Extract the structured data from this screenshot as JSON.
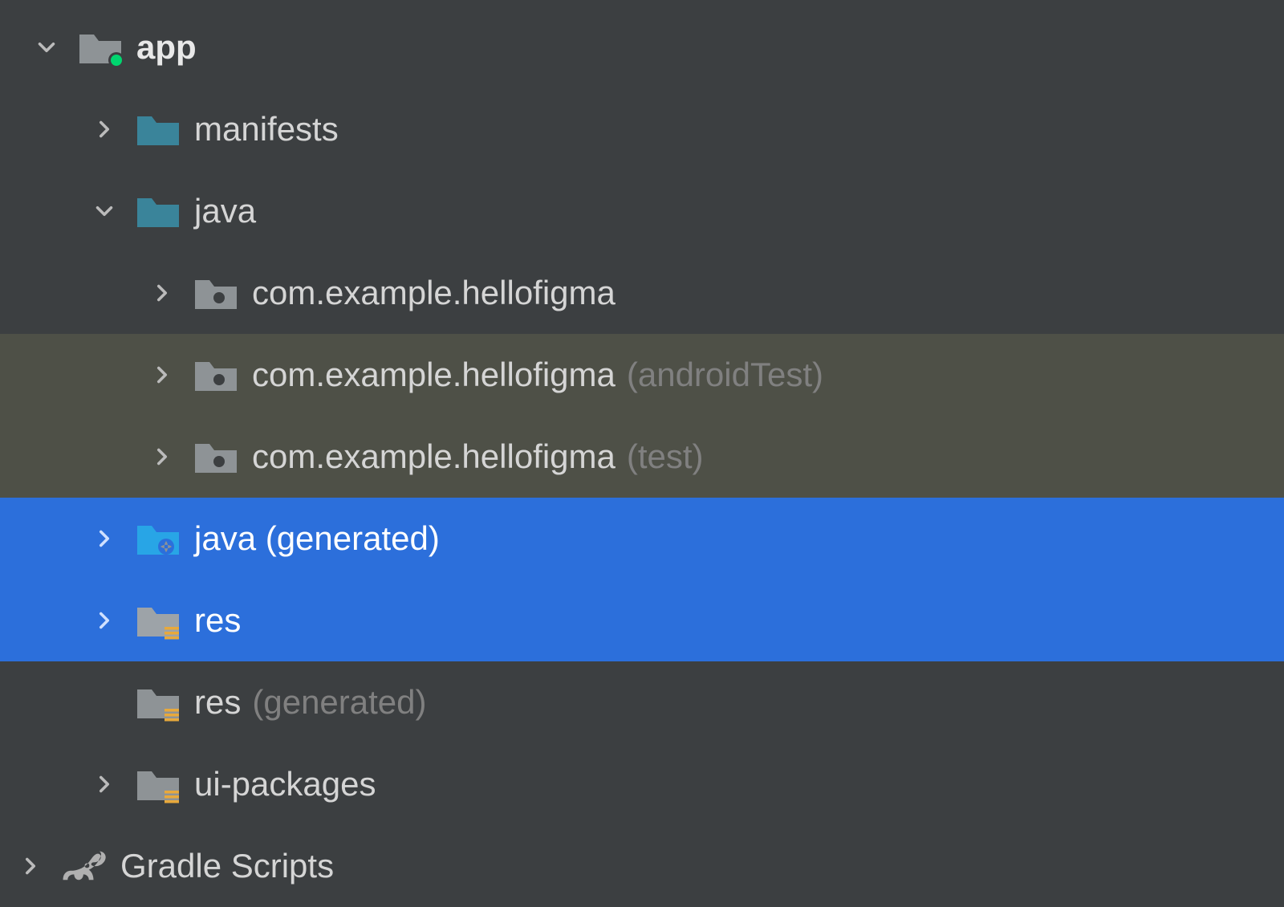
{
  "tree": {
    "app": {
      "label": "app",
      "manifests": "manifests",
      "java": "java",
      "pkg1": "com.example.hellofigma",
      "pkg2": "com.example.hellofigma",
      "pkg2_suffix": "(androidTest)",
      "pkg3": "com.example.hellofigma",
      "pkg3_suffix": "(test)",
      "java_gen": "java (generated)",
      "res": "res",
      "res_gen": "res",
      "res_gen_suffix": "(generated)",
      "ui_packages": "ui-packages"
    },
    "gradle": "Gradle Scripts"
  }
}
